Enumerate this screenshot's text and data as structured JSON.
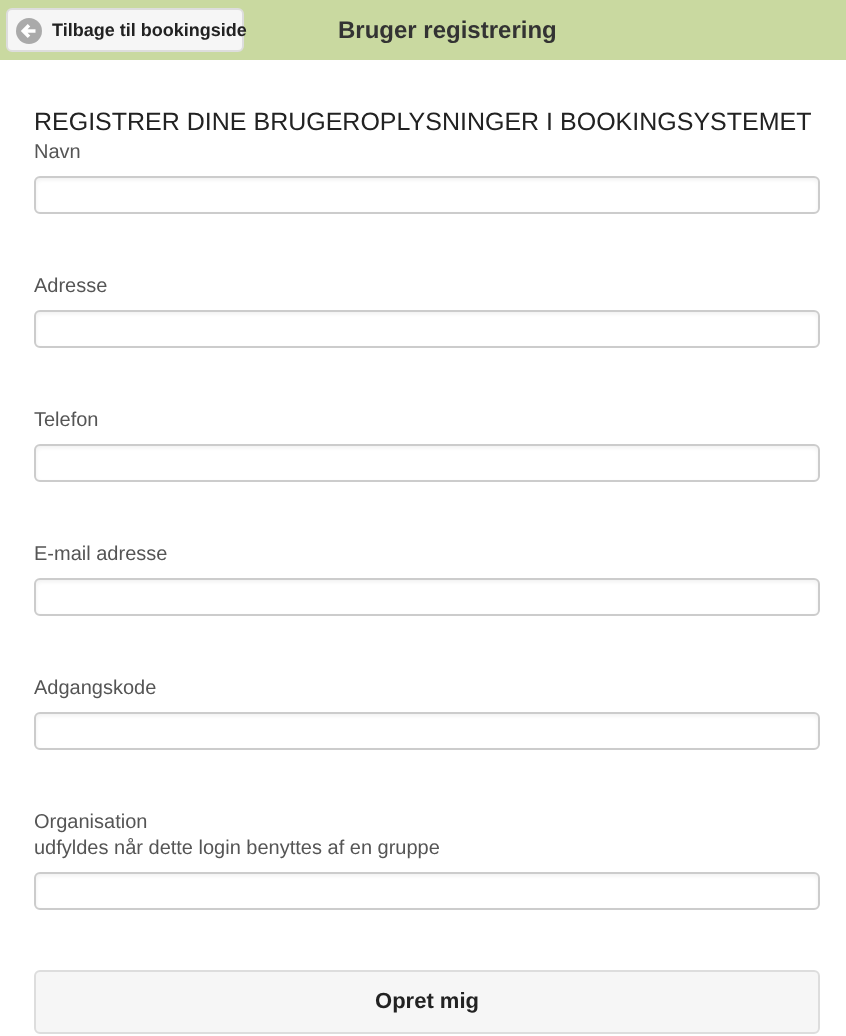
{
  "header": {
    "back_button": "Tilbage til bookingside",
    "title": "Bruger registrering"
  },
  "form": {
    "heading": "REGISTRER DINE BRUGEROPLYSNINGER I BOOKINGSYSTEMET",
    "fields": [
      {
        "label": "Navn"
      },
      {
        "label": "Adresse"
      },
      {
        "label": "Telefon"
      },
      {
        "label": "E-mail adresse"
      },
      {
        "label": "Adgangskode"
      },
      {
        "label": "Organisation",
        "hint": "udfyldes når dette login benyttes af en gruppe"
      }
    ],
    "submit": "Opret mig"
  }
}
